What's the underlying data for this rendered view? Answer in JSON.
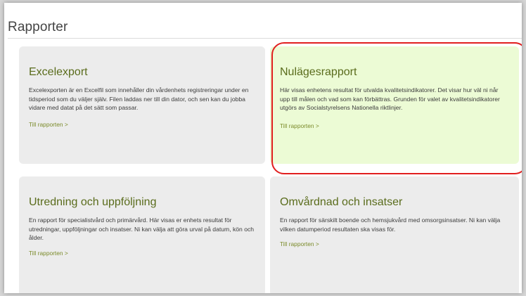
{
  "page": {
    "title": "Rapporter"
  },
  "cards": [
    {
      "title": "Excelexport",
      "description": "Excelexporten är en Excelfil som innehåller din vårdenhets registreringar under en tidsperiod som du väljer själv. Filen laddas ner till din dator, och sen kan du jobba vidare med datat på det sätt som passar.",
      "link": "Till rapporten >"
    },
    {
      "title": "Nulägesrapport",
      "description": "Här visas enhetens resultat för utvalda kvalitetsindikatorer. Det visar hur väl ni når upp till målen och vad som kan förbättras. Grunden för valet av kvalitetsindikatorer utgörs av Socialstyrelsens Nationella riktlinjer.",
      "link": "Till rapporten >"
    },
    {
      "title": "Utredning och uppföljning",
      "description": "En rapport för specialistvård och primärvård. Här visas er enhets resultat för utredningar, uppföljningar och insatser. Ni kan välja att göra urval på datum, kön och ålder.",
      "link": "Till rapporten >"
    },
    {
      "title": "Omvårdnad och insatser",
      "description": "En rapport för särskilt boende och hemsjukvård med omsorgsinsatser. Ni kan välja vilken datumperiod resultaten ska visas för.",
      "link": "Till rapporten >"
    }
  ],
  "colors": {
    "card_background": "#ececec",
    "highlight_background": "#ecfbd5",
    "highlight_outline": "#e11f1f",
    "title_green": "#5a6c1c",
    "link_green": "#7b8b2a"
  }
}
